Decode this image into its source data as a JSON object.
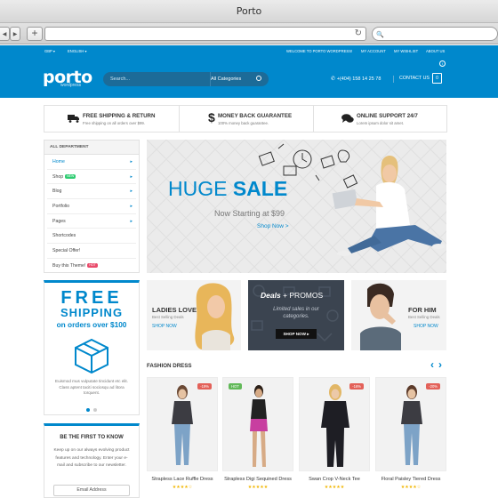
{
  "browser": {
    "window_title": "Porto",
    "back_icon": "◀",
    "forward_icon": "▶",
    "new_tab_icon": "+",
    "reload_icon": "↻",
    "search_icon": "🔍"
  },
  "topbar": {
    "currency": "GBP ▾",
    "language": "ENGLISH ▾",
    "welcome": "WELCOME TO PORTO WORDPRESS!",
    "my_account": "MY ACCOUNT",
    "my_wishlist": "MY WISHLIST",
    "about_us": "ABOUT US"
  },
  "header": {
    "logo": "porto",
    "logo_sub": "wordpress",
    "search_placeholder": "Search...",
    "category": "All Categories",
    "phone": "+(404) 158 14 25 78",
    "contact": "CONTACT US",
    "cart_count": "0",
    "brand_color": "#0088cc"
  },
  "features": [
    {
      "title": "FREE SHIPPING & RETURN",
      "subtitle": "Free shipping on all orders over $99.",
      "icon": "truck-icon"
    },
    {
      "title": "MONEY BACK GUARANTEE",
      "subtitle": "100% money back guarantee.",
      "icon": "dollar-icon"
    },
    {
      "title": "ONLINE SUPPORT 24/7",
      "subtitle": "Lorem ipsum dolor sit amet.",
      "icon": "chat-icon"
    }
  ],
  "sidebar": {
    "heading": "ALL DEPARTMENT",
    "items": [
      {
        "label": "Home",
        "arrow": "▸"
      },
      {
        "label": "Shop",
        "badge": "NEW",
        "arrow": "▸"
      },
      {
        "label": "Blog",
        "arrow": "▸"
      },
      {
        "label": "Portfolio",
        "arrow": "▸"
      },
      {
        "label": "Pages",
        "arrow": "▸"
      },
      {
        "label": "Shortcodes"
      },
      {
        "label": "Special Offer!"
      },
      {
        "label": "Buy this Theme!",
        "badge": "HOT"
      }
    ]
  },
  "hero": {
    "huge": "HUGE",
    "sale": "SALE",
    "now": "Now Starting at $99",
    "shop": "Shop Now >"
  },
  "free_shipping": {
    "line1": "FREE",
    "line2": "SHIPPING",
    "line3": "on orders over $100",
    "text": "Euismod mus vulputate tincidunt etc elit. Class aptent taciti sociosqu ad litora torquent."
  },
  "newsletter": {
    "heading": "BE THE FIRST TO KNOW",
    "text": "Keep up on our always evolving product features and technology. Enter your e-mail and subscribe to our newsletter.",
    "placeholder": "Email Address"
  },
  "promos": [
    {
      "title": "LADIES LOVE",
      "sub": "Best Selling Deals",
      "shop": "SHOP NOW"
    },
    {
      "title1": "Deals",
      "title2": "+ PROMOS",
      "sub": "Limited sales in our categories.",
      "button": "SHOP NOW ▸"
    },
    {
      "title": "FOR HIM",
      "sub": "Best Selling Deals",
      "shop": "SHOP NOW"
    }
  ],
  "products_section": {
    "title": "FASHION DRESS",
    "prev": "‹",
    "next": "›",
    "items": [
      {
        "name": "Strapless Lace Ruffle Dress",
        "tag": "-19%",
        "stars": "★★★★☆"
      },
      {
        "name": "Strapless Digi Sequined Dress",
        "tag": "HOT",
        "stars": "★★★★★"
      },
      {
        "name": "Swan Crop V-Neck Tee",
        "tag": "-16%",
        "stars": "★★★★★"
      },
      {
        "name": "Floral Paisley Tiered Dress",
        "tag": "-20%",
        "stars": "★★★★☆"
      }
    ]
  }
}
